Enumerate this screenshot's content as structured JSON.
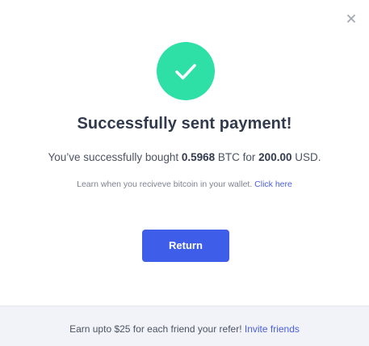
{
  "close": {
    "icon": "close-icon"
  },
  "success": {
    "icon": "checkmark-icon",
    "color": "#2ee0a6"
  },
  "title": "Successfully sent payment!",
  "summary": {
    "prefix": "You’ve successfully bought ",
    "amount_btc": "0.5968",
    "middle": " BTC for ",
    "amount_usd": "200.00",
    "suffix": " USD."
  },
  "learn": {
    "text": "Learn when you reciveve bitcoin in your wallet. ",
    "link_label": "Click here"
  },
  "return_button": {
    "label": "Return",
    "color": "#3e5de8"
  },
  "footer": {
    "text": "Earn upto $25 for each friend your refer! ",
    "link_label": "Invite friends"
  }
}
